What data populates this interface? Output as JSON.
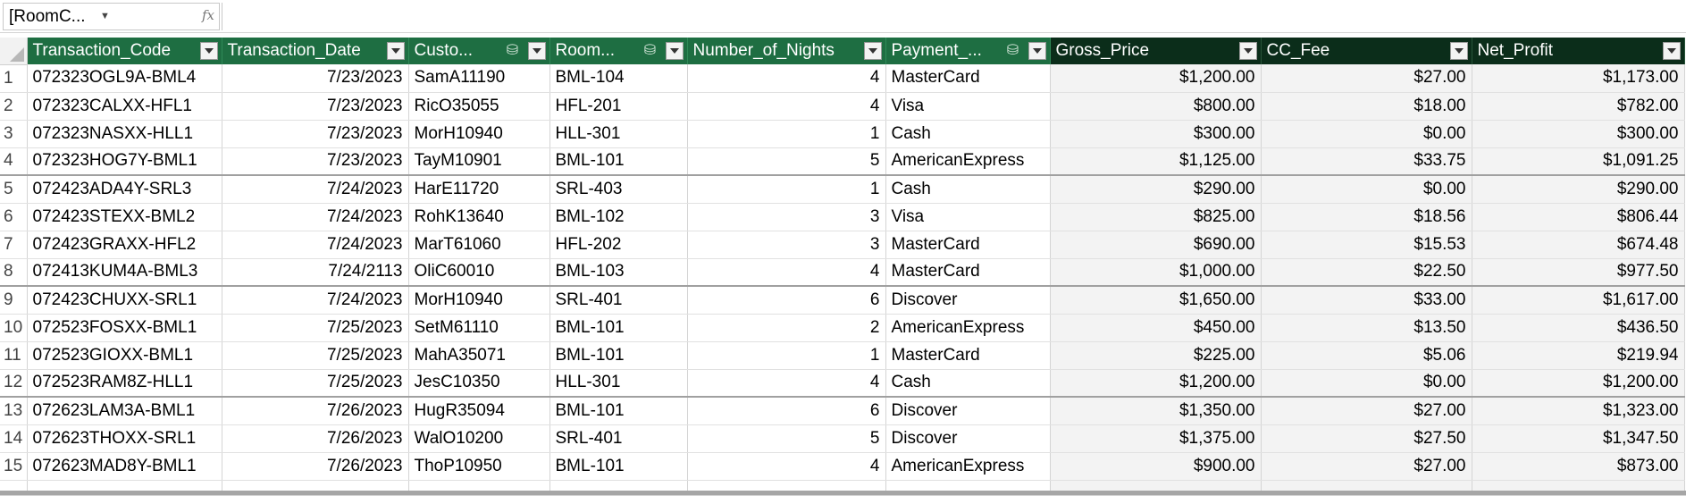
{
  "name_box": {
    "value": "[RoomC...",
    "fx_label": "fx"
  },
  "formula_bar": {
    "value": ""
  },
  "columns": [
    {
      "label": "Transaction_Code",
      "rel_icon": false,
      "dark": false,
      "align": "l"
    },
    {
      "label": "Transaction_Date",
      "rel_icon": false,
      "dark": false,
      "align": "r"
    },
    {
      "label": "Custo...",
      "rel_icon": true,
      "dark": false,
      "align": "l"
    },
    {
      "label": "Room...",
      "rel_icon": true,
      "dark": false,
      "align": "l"
    },
    {
      "label": "Number_of_Nights",
      "rel_icon": false,
      "dark": false,
      "align": "r"
    },
    {
      "label": "Payment_...",
      "rel_icon": true,
      "dark": false,
      "align": "l"
    },
    {
      "label": "Gross_Price",
      "rel_icon": false,
      "dark": true,
      "align": "r"
    },
    {
      "label": "CC_Fee",
      "rel_icon": false,
      "dark": true,
      "align": "r"
    },
    {
      "label": "Net_Profit",
      "rel_icon": false,
      "dark": true,
      "align": "r"
    }
  ],
  "rows": [
    {
      "n": "1",
      "cells": [
        "072323OGL9A-BML4",
        "7/23/2023",
        "SamA11190",
        "BML-104",
        "4",
        "MasterCard",
        "$1,200.00",
        "$27.00",
        "$1,173.00"
      ]
    },
    {
      "n": "2",
      "cells": [
        "072323CALXX-HFL1",
        "7/23/2023",
        "RicO35055",
        "HFL-201",
        "4",
        "Visa",
        "$800.00",
        "$18.00",
        "$782.00"
      ]
    },
    {
      "n": "3",
      "cells": [
        "072323NASXX-HLL1",
        "7/23/2023",
        "MorH10940",
        "HLL-301",
        "1",
        "Cash",
        "$300.00",
        "$0.00",
        "$300.00"
      ]
    },
    {
      "n": "4",
      "cells": [
        "072323HOG7Y-BML1",
        "7/23/2023",
        "TayM10901",
        "BML-101",
        "5",
        "AmericanExpress",
        "$1,125.00",
        "$33.75",
        "$1,091.25"
      ]
    },
    {
      "n": "5",
      "cells": [
        "072423ADA4Y-SRL3",
        "7/24/2023",
        "HarE11720",
        "SRL-403",
        "1",
        "Cash",
        "$290.00",
        "$0.00",
        "$290.00"
      ]
    },
    {
      "n": "6",
      "cells": [
        "072423STEXX-BML2",
        "7/24/2023",
        "RohK13640",
        "BML-102",
        "3",
        "Visa",
        "$825.00",
        "$18.56",
        "$806.44"
      ]
    },
    {
      "n": "7",
      "cells": [
        "072423GRAXX-HFL2",
        "7/24/2023",
        "MarT61060",
        "HFL-202",
        "3",
        "MasterCard",
        "$690.00",
        "$15.53",
        "$674.48"
      ]
    },
    {
      "n": "8",
      "cells": [
        "072413KUM4A-BML3",
        "7/24/2113",
        "OliC60010",
        "BML-103",
        "4",
        "MasterCard",
        "$1,000.00",
        "$22.50",
        "$977.50"
      ]
    },
    {
      "n": "9",
      "cells": [
        "072423CHUXX-SRL1",
        "7/24/2023",
        "MorH10940",
        "SRL-401",
        "6",
        "Discover",
        "$1,650.00",
        "$33.00",
        "$1,617.00"
      ]
    },
    {
      "n": "10",
      "cells": [
        "072523FOSXX-BML1",
        "7/25/2023",
        "SetM61110",
        "BML-101",
        "2",
        "AmericanExpress",
        "$450.00",
        "$13.50",
        "$436.50"
      ]
    },
    {
      "n": "11",
      "cells": [
        "072523GIOXX-BML1",
        "7/25/2023",
        "MahA35071",
        "BML-101",
        "1",
        "MasterCard",
        "$225.00",
        "$5.06",
        "$219.94"
      ]
    },
    {
      "n": "12",
      "cells": [
        "072523RAM8Z-HLL1",
        "7/25/2023",
        "JesC10350",
        "HLL-301",
        "4",
        "Cash",
        "$1,200.00",
        "$0.00",
        "$1,200.00"
      ]
    },
    {
      "n": "13",
      "cells": [
        "072623LAM3A-BML1",
        "7/26/2023",
        "HugR35094",
        "BML-101",
        "6",
        "Discover",
        "$1,350.00",
        "$27.00",
        "$1,323.00"
      ]
    },
    {
      "n": "14",
      "cells": [
        "072623THOXX-SRL1",
        "7/26/2023",
        "WalO10200",
        "SRL-401",
        "5",
        "Discover",
        "$1,375.00",
        "$27.50",
        "$1,347.50"
      ]
    },
    {
      "n": "15",
      "cells": [
        "072623MAD8Y-BML1",
        "7/26/2023",
        "ThoP10950",
        "BML-101",
        "4",
        "AmericanExpress",
        "$900.00",
        "$27.00",
        "$873.00"
      ]
    }
  ],
  "separator_after_rows": [
    "4",
    "8",
    "12"
  ]
}
